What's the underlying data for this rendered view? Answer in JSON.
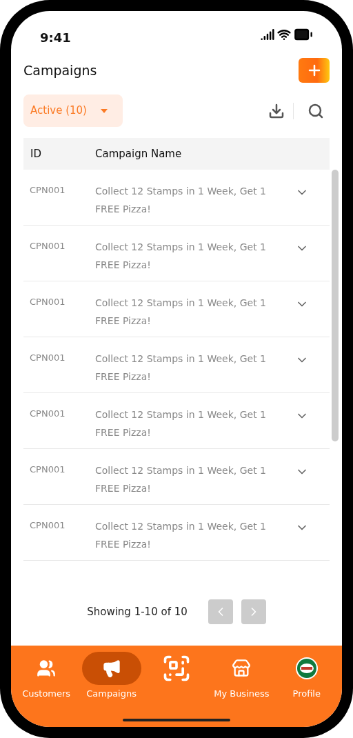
{
  "status_bar": {
    "time": "9:41"
  },
  "header": {
    "title": "Campaigns"
  },
  "filter": {
    "label": "Active (10)"
  },
  "table": {
    "columns": [
      "ID",
      "Campaign Name"
    ],
    "rows": [
      {
        "id": "CPN001",
        "name": "Collect 12 Stamps in 1 Week, Get 1 FREE Pizza!",
        "expanded": false
      },
      {
        "id": "CPN001",
        "name": "Collect 12 Stamps in 1 Week, Get 1 FREE Pizza!",
        "expanded": false
      },
      {
        "id": "CPN001",
        "name": "Collect 12 Stamps in 1 Week, Get 1 FREE Pizza!",
        "expanded": false
      },
      {
        "id": "CPN001",
        "name": "Collect 12 Stamps in 1 Week, Get 1 FREE Pizza!",
        "expanded": false
      },
      {
        "id": "CPN001",
        "name": "Collect 12 Stamps in 1 Week, Get 1 FREE Pizza!",
        "expanded": false
      },
      {
        "id": "CPN001",
        "name": "Collect 12 Stamps in 1 Week, Get 1 FREE Pizza!",
        "expanded": false
      },
      {
        "id": "CPN001",
        "name": "Collect 12 Stamps in 1 Week, Get 1 FREE Pizza!",
        "expanded": false
      }
    ]
  },
  "pagination": {
    "summary": "Showing 1-10 of 10",
    "prev_disabled": true,
    "next_disabled": true
  },
  "nav": [
    {
      "kind": "customers",
      "label": "Customers",
      "selected": false
    },
    {
      "kind": "campaigns",
      "label": "Campaigns",
      "selected": true
    },
    {
      "kind": "scan",
      "selected": false
    },
    {
      "kind": "business",
      "label": "My Business",
      "selected": false
    },
    {
      "kind": "profile",
      "label": "Profile",
      "selected": false
    }
  ]
}
